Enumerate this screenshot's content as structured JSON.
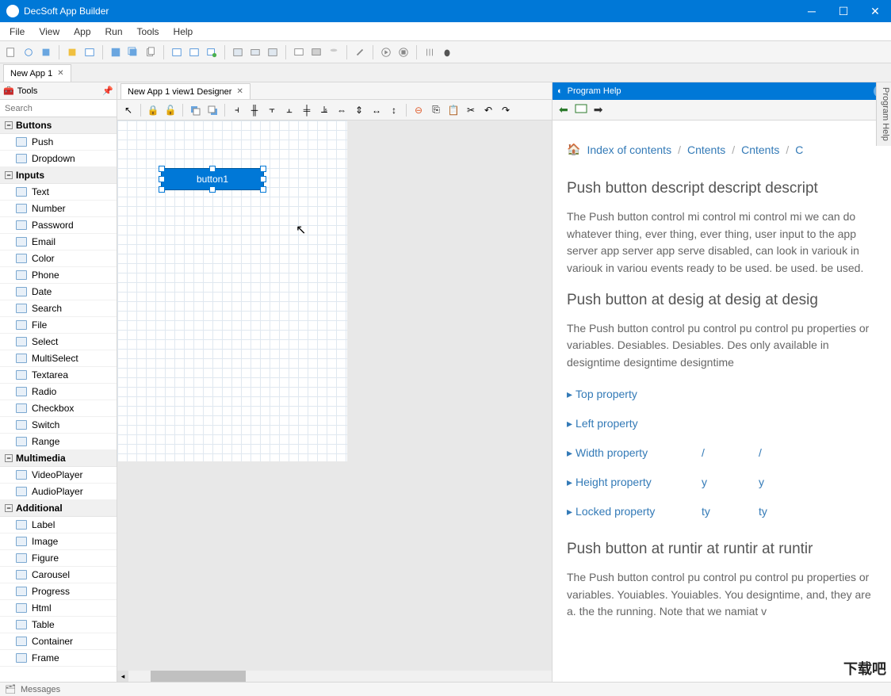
{
  "app": {
    "title": "DecSoft App Builder"
  },
  "menubar": [
    "File",
    "View",
    "App",
    "Run",
    "Tools",
    "Help"
  ],
  "app_tabs": [
    {
      "label": "New App 1"
    }
  ],
  "tools_panel": {
    "title": "Tools",
    "search_placeholder": "Search",
    "categories": [
      {
        "name": "Buttons",
        "items": [
          "Push",
          "Dropdown"
        ]
      },
      {
        "name": "Inputs",
        "items": [
          "Text",
          "Number",
          "Password",
          "Email",
          "Color",
          "Phone",
          "Date",
          "Search",
          "File",
          "Select",
          "MultiSelect",
          "Textarea",
          "Radio",
          "Checkbox",
          "Switch",
          "Range"
        ]
      },
      {
        "name": "Multimedia",
        "items": [
          "VideoPlayer",
          "AudioPlayer"
        ]
      },
      {
        "name": "Additional",
        "items": [
          "Label",
          "Image",
          "Figure",
          "Carousel",
          "Progress",
          "Html",
          "Table",
          "Container",
          "Frame"
        ]
      }
    ]
  },
  "designer": {
    "tab_label": "New App 1 view1 Designer",
    "button_label": "button1"
  },
  "help": {
    "panel_title": "Program Help",
    "vertical_label": "Program Help",
    "breadcrumb": [
      "Index of contents",
      "Cntents",
      "Cntents",
      "C"
    ],
    "h1": "Push button descript descript descript",
    "p1": "The Push button control mi control mi control mi we can do whatever thing, ever thing, ever thing, user input to the app server app server app serve disabled, can look in variouk in variouk in variou events ready to be used.    be used.    be used.",
    "h2": "Push button at desig at desig at desig",
    "p2": "The Push button control pu control pu control pu properties or variables. Desiables. Desiables. Des only available in designtime designtime designtime",
    "links": [
      "Top property",
      "Left property",
      "Width property",
      "Height property",
      "Locked property"
    ],
    "linksb": [
      "",
      "",
      "/",
      "y",
      "ty"
    ],
    "linksc": [
      "",
      "",
      "/",
      "y",
      "ty"
    ],
    "h3": "Push button at runtir at runtir at runtir",
    "p3": "The Push button control pu control pu control pu properties or variables. Youiables. Youiables. You designtime, and, they are a. the     the     running. Note that we namiat v"
  },
  "statusbar": {
    "messages": "Messages"
  },
  "watermark": "下载吧"
}
